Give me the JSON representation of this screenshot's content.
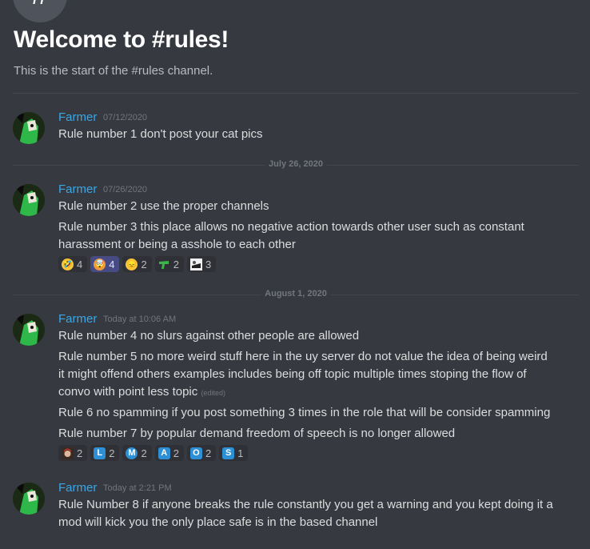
{
  "channel": {
    "icon": "hash-icon",
    "welcome_title": "Welcome to #rules!",
    "welcome_subtitle": "This is the start of the #rules channel."
  },
  "dividers": {
    "d1": "July 26, 2020",
    "d2": "August 1, 2020"
  },
  "messages": [
    {
      "author": "Farmer",
      "timestamp": "07/12/2020",
      "lines": [
        "Rule number 1 don't post your cat pics"
      ]
    },
    {
      "author": "Farmer",
      "timestamp": "07/26/2020",
      "lines": [
        "Rule number 2 use the proper channels",
        "Rule number 3 this place allows no negative action towards other user such as constant",
        "harassment or being a asshole to each other"
      ],
      "reactions": [
        {
          "emoji": "rolling-on-floor-laughing",
          "count": "4"
        },
        {
          "emoji": "exploding-head",
          "count": "4",
          "reacted": true
        },
        {
          "emoji": "disappointed-face",
          "count": "2"
        },
        {
          "emoji": "custom-green-gun",
          "count": "2"
        },
        {
          "emoji": "custom-meme-image",
          "count": "3"
        }
      ]
    },
    {
      "author": "Farmer",
      "timestamp": "Today at 10:06 AM",
      "lines": [
        "Rule number 4 no slurs against other people are allowed",
        "Rule number 5 no more weird stuff here in the uy server do not value the idea of being weird",
        "it might offend others examples includes being off topic multiple times stoping the flow of",
        "convo with point less topic",
        "Rule 6 no spamming if you post something 3 times in the role that will be consider spamming",
        "Rule number 7 by popular demand freedom of speech is no longer allowed"
      ],
      "edited": "(edited)",
      "reactions": [
        {
          "emoji": "custom-avatar",
          "count": "2"
        },
        {
          "emoji": "regional-l",
          "label": "L",
          "count": "2"
        },
        {
          "emoji": "circled-m",
          "label": "M",
          "count": "2"
        },
        {
          "emoji": "regional-a",
          "label": "A",
          "count": "2"
        },
        {
          "emoji": "regional-o",
          "label": "O",
          "count": "2"
        },
        {
          "emoji": "regional-s",
          "label": "S",
          "count": "1"
        }
      ]
    },
    {
      "author": "Farmer",
      "timestamp": "Today at 2:21 PM",
      "lines": [
        "Rule Number 8 if anyone breaks the rule constantly you get a warning and you kept doing it a",
        "mod will kick you the only place safe is in the based channel"
      ]
    }
  ],
  "colors": {
    "background": "#36393f",
    "username": "#3aa7e6",
    "text": "#dcddde",
    "muted": "#72767d"
  }
}
